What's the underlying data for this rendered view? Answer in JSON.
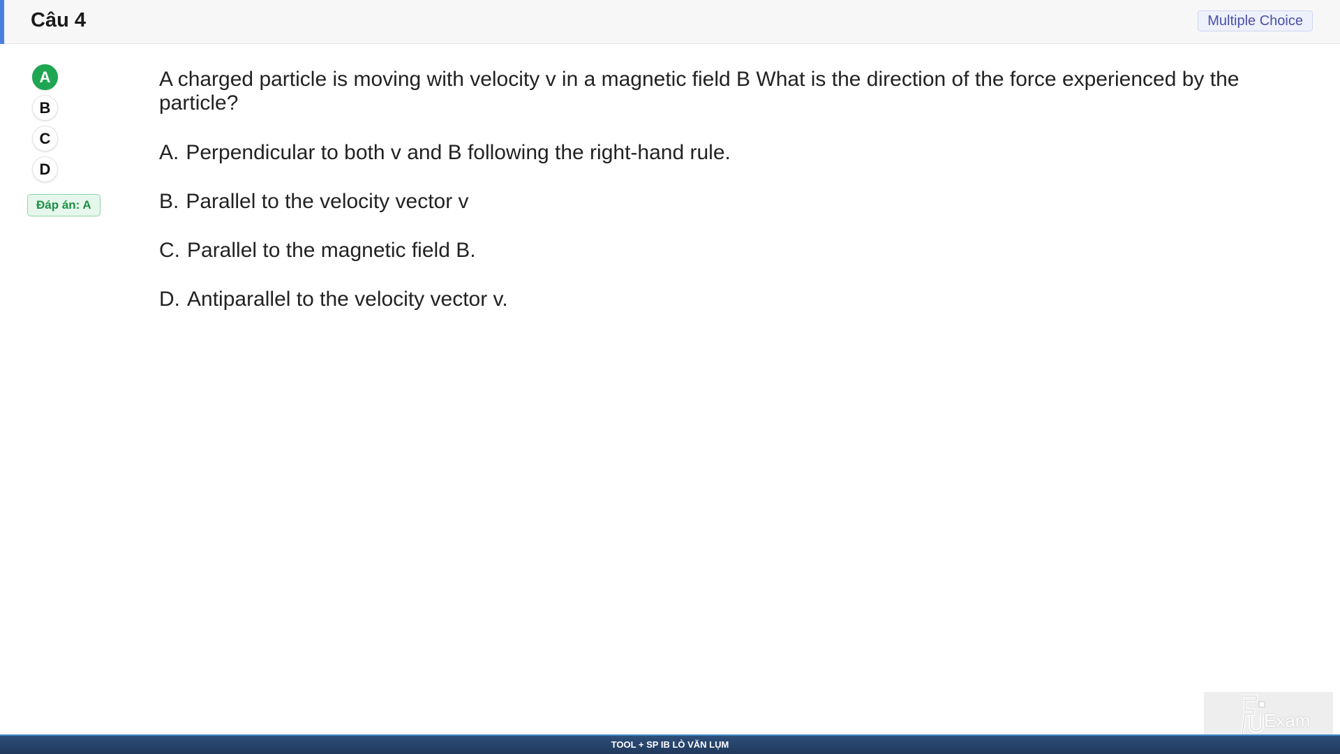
{
  "header": {
    "title": "Câu 4",
    "question_type": "Multiple Choice",
    "accent_color": "#4a7fe0"
  },
  "answers": {
    "choices": [
      "A",
      "B",
      "C",
      "D"
    ],
    "selected": "A",
    "selected_color": "#1ea653",
    "answer_key_label": "Đáp án: A"
  },
  "question": {
    "text": "A charged particle is moving with velocity v in a magnetic field B What is the direction of the force experienced by the particle?",
    "options": [
      {
        "letter": "A.",
        "text": "Perpendicular to both v and B following the right-hand rule."
      },
      {
        "letter": "B.",
        "text": "Parallel to the velocity vector v"
      },
      {
        "letter": "C.",
        "text": "Parallel to the magnetic field B."
      },
      {
        "letter": "D.",
        "text": "Antiparallel to the velocity vector v."
      }
    ]
  },
  "footer": {
    "text": "TOOL + SP IB LÒ VĂN LỤM"
  },
  "logo": {
    "icon": "fu-exam-logo-icon",
    "text": "Exam"
  }
}
